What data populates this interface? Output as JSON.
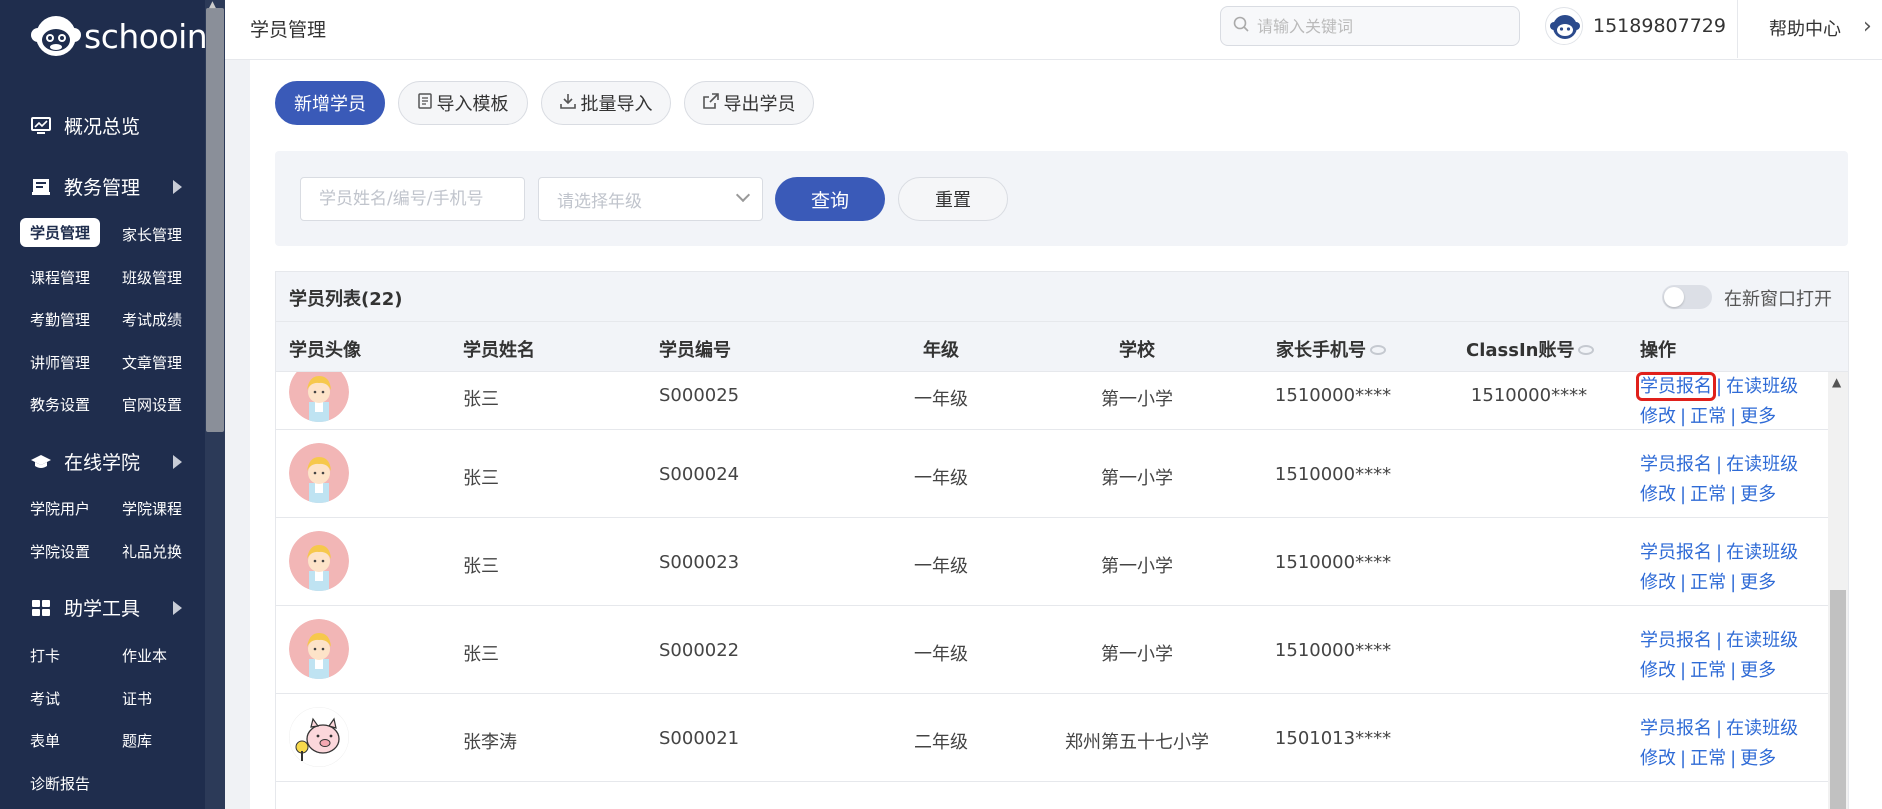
{
  "app": {
    "logo_text": "schooin",
    "page_title": "学员管理"
  },
  "sidebar": {
    "sections": [
      {
        "label": "概况总览"
      },
      {
        "label": "教务管理"
      },
      {
        "label": "在线学院"
      },
      {
        "label": "助学工具"
      }
    ],
    "items": {
      "student_mgmt": "学员管理",
      "parent_mgmt": "家长管理",
      "course_mgmt": "课程管理",
      "class_mgmt": "班级管理",
      "attendance_mgmt": "考勤管理",
      "exam_scores": "考试成绩",
      "teacher_mgmt": "讲师管理",
      "article_mgmt": "文章管理",
      "edu_settings": "教务设置",
      "site_settings": "官网设置",
      "academy_users": "学院用户",
      "academy_courses": "学院课程",
      "academy_settings": "学院设置",
      "gift_exchange": "礼品兑换",
      "checkin": "打卡",
      "homework": "作业本",
      "exam": "考试",
      "certificate": "证书",
      "form": "表单",
      "question_bank": "题库",
      "diagnosis_report": "诊断报告"
    }
  },
  "topbar": {
    "search_placeholder": "请输入关键词",
    "phone": "15189807729",
    "help": "帮助中心"
  },
  "toolbar": {
    "add_student": "新增学员",
    "import_template": "导入模板",
    "batch_import": "批量导入",
    "export_students": "导出学员"
  },
  "filter": {
    "name_placeholder": "学员姓名/编号/手机号",
    "grade_placeholder": "请选择年级",
    "query": "查询",
    "reset": "重置"
  },
  "list": {
    "title": "学员列表(22)",
    "new_window_label": "在新窗口打开",
    "new_window_on": false,
    "columns": {
      "avatar": "学员头像",
      "name": "学员姓名",
      "code": "学员编号",
      "grade": "年级",
      "school": "学校",
      "parent_phone": "家长手机号",
      "classin": "ClassIn账号",
      "ops": "操作"
    },
    "ops_labels": {
      "enroll": "学员报名",
      "classes": "在读班级",
      "edit": "修改",
      "status": "正常",
      "more": "更多",
      "sep": "|"
    },
    "rows": [
      {
        "name": "张三",
        "code": "S000025",
        "grade": "一年级",
        "school": "第一小学",
        "parent_phone": "1510000****",
        "classin": "1510000****",
        "avatar": "girl"
      },
      {
        "name": "张三",
        "code": "S000024",
        "grade": "一年级",
        "school": "第一小学",
        "parent_phone": "1510000****",
        "classin": "",
        "avatar": "girl"
      },
      {
        "name": "张三",
        "code": "S000023",
        "grade": "一年级",
        "school": "第一小学",
        "parent_phone": "1510000****",
        "classin": "",
        "avatar": "girl"
      },
      {
        "name": "张三",
        "code": "S000022",
        "grade": "一年级",
        "school": "第一小学",
        "parent_phone": "1510000****",
        "classin": "",
        "avatar": "girl"
      },
      {
        "name": "张李涛",
        "code": "S000021",
        "grade": "二年级",
        "school": "郑州第五十七小学",
        "parent_phone": "1501013****",
        "classin": "",
        "avatar": "pig"
      }
    ]
  },
  "colors": {
    "sidebar_bg": "#1f2d4d",
    "primary": "#3a5ab8",
    "link": "#2f6bd6",
    "highlight": "#e0201b"
  }
}
